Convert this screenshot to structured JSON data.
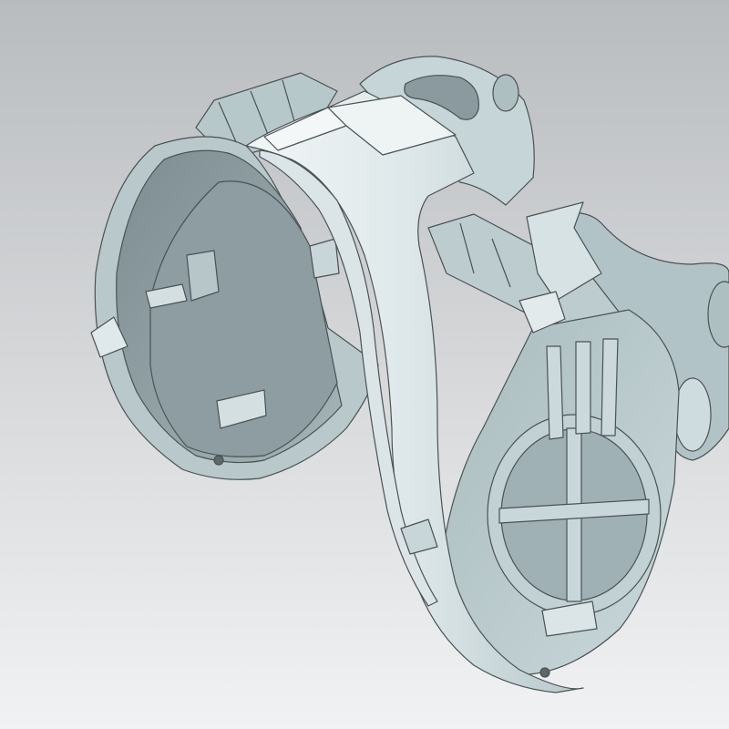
{
  "viewport": {
    "background_top": "#b9bcbf",
    "background_bottom": "#f1f2f3",
    "frame_color": "#9aa0a6"
  },
  "model": {
    "name": "",
    "colors": {
      "surface_light": "#e6eef0",
      "surface_mid": "#c3d3d6",
      "surface_dark": "#8fa3a8",
      "inner_shadow": "#93a4a7",
      "highlight": "#f6f9fa",
      "edge": "#4a5254"
    }
  }
}
